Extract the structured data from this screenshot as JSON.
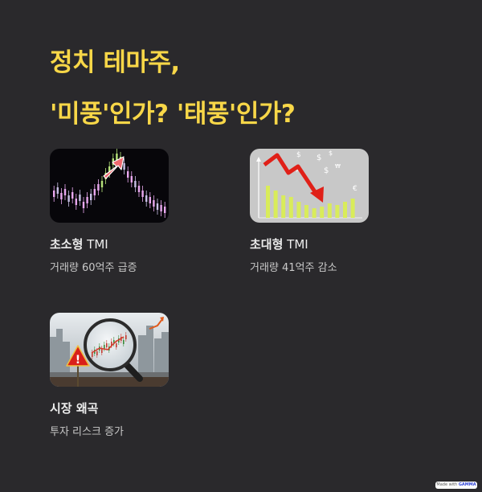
{
  "title": {
    "line1": "정치 테마주,",
    "line2": "'미풍'인가?  '태풍'인가?"
  },
  "cards": [
    {
      "title_bold": "초소형",
      "title_rest": " TMI",
      "subtitle": "거래량 60억주 급증",
      "image_icon": "candlestick-chart-rising-arrow-icon"
    },
    {
      "title_bold": "초대형",
      "title_rest": " TMI",
      "subtitle": "거래량 41억주 감소",
      "image_icon": "falling-arrow-bar-chart-icon"
    },
    {
      "title_bold": "시장 왜곡",
      "title_rest": "",
      "subtitle": "투자 리스크 증가",
      "image_icon": "magnifier-warning-chart-icon"
    }
  ],
  "badge": {
    "prefix": "Made with ",
    "brand": "GAMMA"
  },
  "colors": {
    "background": "#2a292c",
    "title": "#f8d748",
    "card_title": "#ececec",
    "card_subtitle": "#c9c9c9",
    "card1_arrow": "#ef6a70",
    "card2_arrow": "#e02018",
    "card2_bars": "#d9ec5a"
  }
}
